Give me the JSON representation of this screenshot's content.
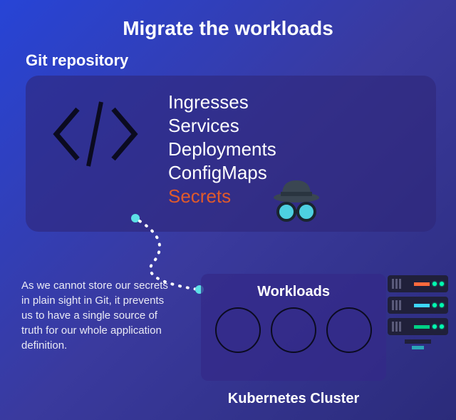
{
  "title": "Migrate the workloads",
  "git_label": "Git repository",
  "resources": {
    "r0": "Ingresses",
    "r1": "Services",
    "r2": "Deployments",
    "r3": "ConfigMaps",
    "r4": "Secrets"
  },
  "note": "As we cannot store our secrets in plain sight in Git, it prevents us to have a single source of truth for our whole application definition.",
  "cluster": {
    "panel_title": "Workloads",
    "label": "Kubernetes Cluster"
  },
  "colors": {
    "secrets": "#e05a2b",
    "panel": "#2e2678",
    "bg_start": "#2744d6",
    "bg_end": "#2b2b7a"
  }
}
